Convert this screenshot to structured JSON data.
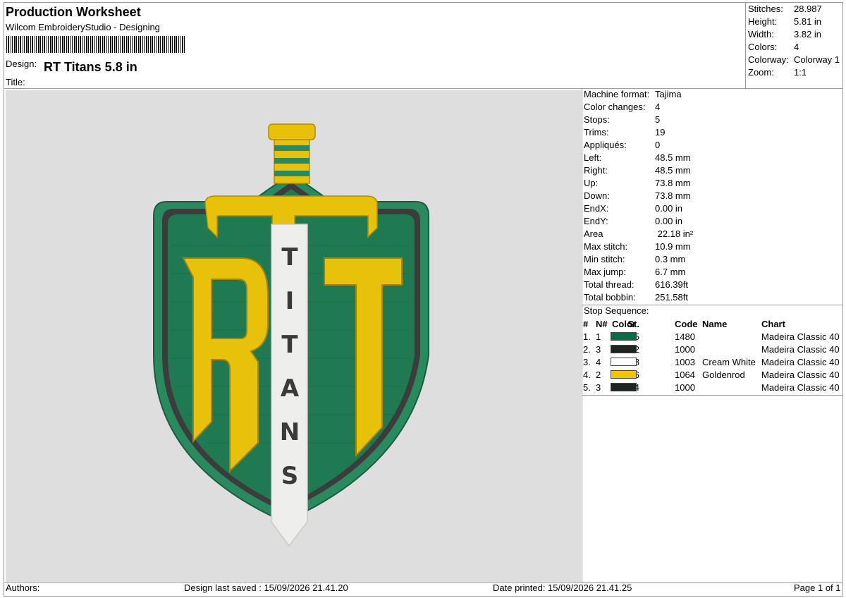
{
  "header": {
    "title": "Production Worksheet",
    "subtitle": "Wilcom EmbroideryStudio - Designing",
    "design_label": "Design:",
    "design_value": "RT Titans 5.8 in",
    "title_label": "Title:"
  },
  "summary": [
    {
      "label": "Stitches:",
      "value": "28.987"
    },
    {
      "label": "Height:",
      "value": "5.81 in"
    },
    {
      "label": "Width:",
      "value": "3.82 in"
    },
    {
      "label": "Colors:",
      "value": "4"
    },
    {
      "label": "Colorway:",
      "value": "Colorway 1"
    },
    {
      "label": "Zoom:",
      "value": "1:1"
    }
  ],
  "stats": [
    {
      "label": "Machine format:",
      "value": "Tajima"
    },
    {
      "label": "Color changes:",
      "value": "4"
    },
    {
      "label": "Stops:",
      "value": "5"
    },
    {
      "label": "Trims:",
      "value": "19"
    },
    {
      "label": "Appliqués:",
      "value": "0"
    },
    {
      "label": "Left:",
      "value": "48.5 mm"
    },
    {
      "label": "Right:",
      "value": "48.5 mm"
    },
    {
      "label": "Up:",
      "value": "73.8 mm"
    },
    {
      "label": "Down:",
      "value": "73.8 mm"
    },
    {
      "label": "EndX:",
      "value": "0.00 in"
    },
    {
      "label": "EndY:",
      "value": "0.00 in"
    },
    {
      "label": "Area",
      "value": " 22.18 in²"
    },
    {
      "label": "Max stitch:",
      "value": "10.9 mm"
    },
    {
      "label": "Min stitch:",
      "value": "0.3 mm"
    },
    {
      "label": "Max jump:",
      "value": "6.7 mm"
    },
    {
      "label": "Total thread:",
      "value": "616.39ft"
    },
    {
      "label": "Total bobbin:",
      "value": "251.58ft"
    }
  ],
  "stop_sequence": {
    "title": "Stop Sequence:",
    "headers": {
      "idx": "#",
      "n": "N#",
      "color": "Color",
      "st": "St.",
      "code": "Code",
      "name": "Name",
      "chart": "Chart"
    },
    "rows": [
      {
        "idx": "1.",
        "n": "1",
        "swatch": "#0b6b47",
        "st": "18.795",
        "code": "1480",
        "name": "",
        "chart": "Madeira Classic 40"
      },
      {
        "idx": "2.",
        "n": "3",
        "swatch": "#1e2420",
        "st": "1.712",
        "code": "1000",
        "name": "",
        "chart": "Madeira Classic 40"
      },
      {
        "idx": "3.",
        "n": "4",
        "swatch": "#ffffff",
        "st": "3.238",
        "code": "1003",
        "name": "Cream White",
        "chart": "Madeira Classic 40"
      },
      {
        "idx": "4.",
        "n": "2",
        "swatch": "#f5c400",
        "st": "4.606",
        "code": "1064",
        "name": "Goldenrod",
        "chart": "Madeira Classic 40"
      },
      {
        "idx": "5.",
        "n": "3",
        "swatch": "#1e2420",
        "st": "634",
        "code": "1000",
        "name": "",
        "chart": "Madeira Classic 40"
      }
    ]
  },
  "design_preview": {
    "letters_left": "R",
    "letters_right": "T",
    "blade_text": [
      "T",
      "I",
      "T",
      "A",
      "N",
      "S"
    ],
    "colors": {
      "shield_green": "#1f7a52",
      "border_green": "#2a8a5f",
      "outline": "#3c3c3c",
      "gold": "#e8c10a",
      "blade": "#eeeeec"
    }
  },
  "footer": {
    "authors": "Authors:",
    "last_saved": "Design last saved : 15/09/2026 21.41.20",
    "printed": "Date printed: 15/09/2026 21.41.25",
    "page": "Page 1 of 1"
  }
}
